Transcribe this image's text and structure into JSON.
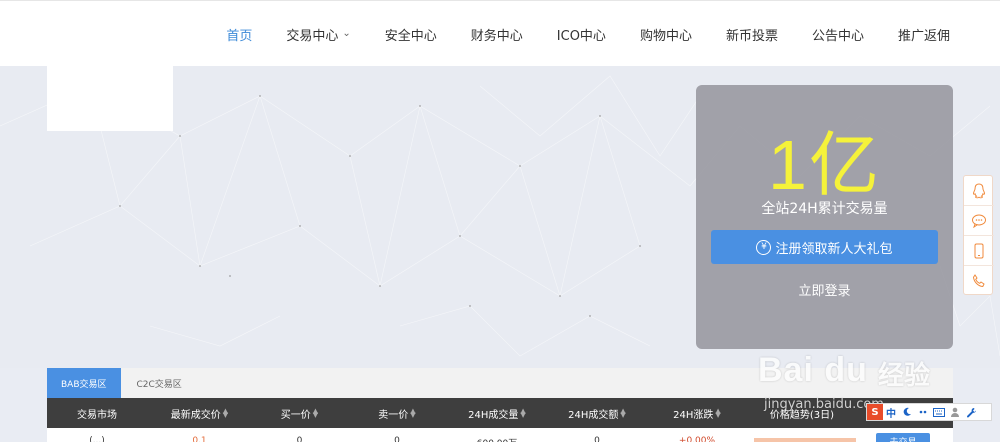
{
  "nav": {
    "items": [
      {
        "label": "首页",
        "active": true
      },
      {
        "label": "交易中心",
        "dropdown": true
      },
      {
        "label": "安全中心"
      },
      {
        "label": "财务中心"
      },
      {
        "label": "ICO中心"
      },
      {
        "label": "购物中心"
      },
      {
        "label": "新币投票"
      },
      {
        "label": "公告中心"
      },
      {
        "label": "推广返佣"
      }
    ]
  },
  "hero": {
    "big_number": "1亿",
    "subtitle": "全站24H累计交易量",
    "register_button": "注册领取新人大礼包",
    "login_link": "立即登录"
  },
  "side_icons": [
    "qq-icon",
    "chat-bubble-icon",
    "mobile-phone-icon",
    "telephone-icon"
  ],
  "market": {
    "tabs": [
      {
        "label": "BAB交易区",
        "active": true
      },
      {
        "label": "C2C交易区",
        "active": false
      }
    ],
    "columns": [
      "交易市场",
      "最新成交价",
      "买一价",
      "卖一价",
      "24H成交量",
      "24H成交额",
      "24H涨跌",
      "价格趋势(3日)"
    ],
    "row": {
      "market": "(...)",
      "last_price": "0.1",
      "buy_price": "0",
      "sell_price": "0",
      "volume": "600.00万",
      "amount": "0",
      "change": "+0.00%",
      "action": "去交易"
    }
  },
  "watermark": {
    "brand": "Bai du",
    "brand_cn": "经验",
    "url": "jingyan.baidu.com"
  },
  "ime": {
    "logo": "S",
    "mode": "中"
  },
  "colors": {
    "accent": "#4a90e2",
    "active_nav": "#3c8ad8",
    "hero_number": "#f5f23a",
    "table_header": "#3e3e3e",
    "up_color": "#e36b3a"
  }
}
